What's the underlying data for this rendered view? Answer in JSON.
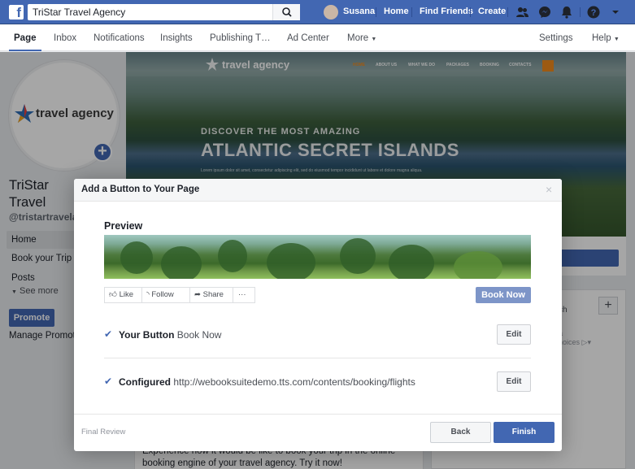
{
  "topbar": {
    "search_value": "TriStar Travel Agency",
    "user_name": "Susana",
    "links": [
      "Home",
      "Find Friends",
      "Create"
    ]
  },
  "page_nav": {
    "tabs": [
      "Page",
      "Inbox",
      "Notifications",
      "Insights",
      "Publishing T…",
      "Ad Center",
      "More"
    ],
    "settings": "Settings",
    "help": "Help"
  },
  "profile": {
    "logo_text": "travel agency",
    "name": "TriStar Travel Agency",
    "handle": "@tristartravelag",
    "nav": [
      "Home",
      "Book your Trip",
      "Posts"
    ],
    "see_more": "See more",
    "promote": "Promote",
    "manage": "Manage Promotions"
  },
  "cover": {
    "logo": "travel agency",
    "nav": [
      "HOME",
      "ABOUT US",
      "WHAT WE DO",
      "PACKAGES",
      "BOOKING",
      "CONTACTS"
    ],
    "kicker": "DISCOVER THE MOST AMAZING",
    "title": "ATLANTIC SECRET ISLANDS",
    "subtitle": "Lorem ipsum dolor sit amet, consectetur adipiscing elit, sed do eiusmod tempor incididunt ut labore et dolore magna aliqua."
  },
  "right": {
    "ch_text": "ch",
    "a_text": "a",
    "choices_text": "hoices"
  },
  "bottom": {
    "text": "Experience how it would be like to book your trip in the online booking engine of your travel agency. Try it now!"
  },
  "dialog": {
    "title": "Add a Button to Your Page",
    "close": "×",
    "preview_label": "Preview",
    "actions": [
      "Like",
      "Follow",
      "Share",
      "···"
    ],
    "book_now": "Book Now",
    "row1_label": "Your Button",
    "row1_value": "Book Now",
    "row2_label": "Configured",
    "row2_value": "http://webooksuitedemo.tts.com/contents/booking/flights",
    "edit": "Edit",
    "final_review": "Final Review",
    "back": "Back",
    "finish": "Finish"
  },
  "colors": {
    "facebook_blue": "#4267b2",
    "book_now_bg": "#7d95c8",
    "cover_orange": "#f28a1c"
  }
}
